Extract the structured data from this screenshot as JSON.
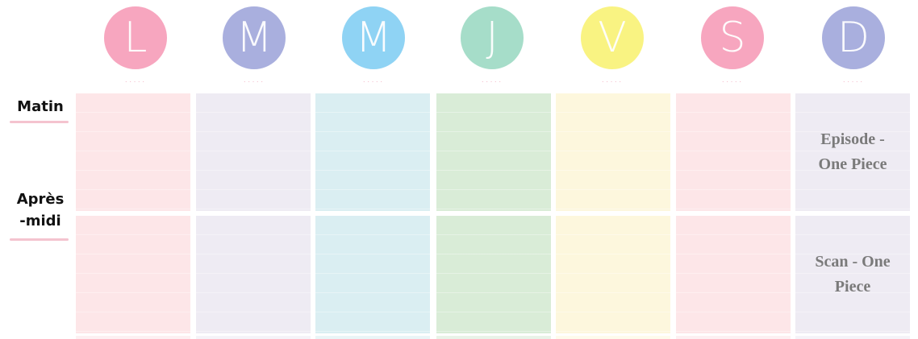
{
  "days": [
    {
      "letter": "L",
      "color": "#f7a6bf",
      "cell_color": "#fde6e8"
    },
    {
      "letter": "M",
      "color": "#a9afde",
      "cell_color": "#eeebf3"
    },
    {
      "letter": "M",
      "color": "#8fd3f4",
      "cell_color": "#daeef2"
    },
    {
      "letter": "J",
      "color": "#a6ddc9",
      "cell_color": "#d9ecd7"
    },
    {
      "letter": "V",
      "color": "#f9f382",
      "cell_color": "#fdf7dd"
    },
    {
      "letter": "S",
      "color": "#f7a6bf",
      "cell_color": "#fde6e8"
    },
    {
      "letter": "D",
      "color": "#a9afde",
      "cell_color": "#eeebf3"
    }
  ],
  "dots_text": "·····",
  "rows": [
    {
      "label_line1": "Matin",
      "label_line2": ""
    },
    {
      "label_line1": "Après",
      "label_line2": "-midi"
    }
  ],
  "entries": {
    "matin_dimanche_line1": "Episode -",
    "matin_dimanche_line2": "One Piece",
    "apres_midi_dimanche_line1": "Scan - One",
    "apres_midi_dimanche_line2": "Piece"
  }
}
